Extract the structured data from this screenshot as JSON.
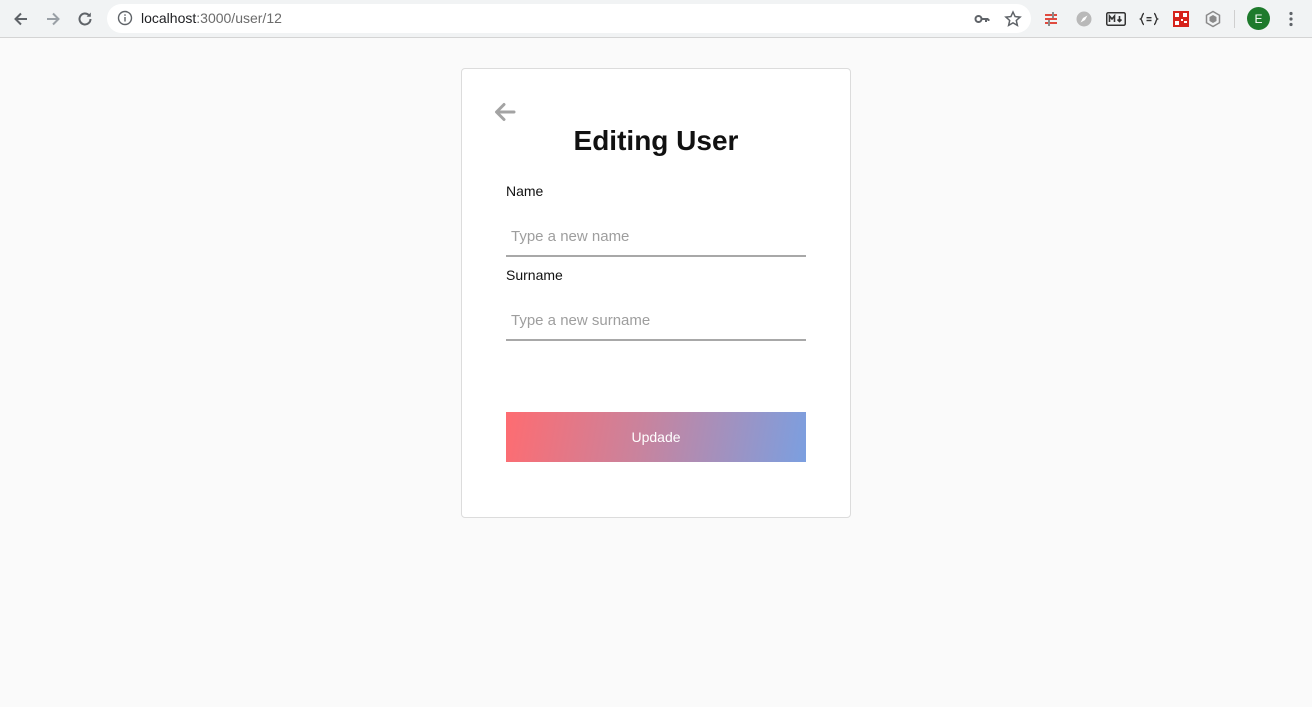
{
  "browser": {
    "url_host": "localhost",
    "url_path": ":3000/user/12",
    "profile_initial": "E",
    "icons": {
      "back": "back-arrow-icon",
      "forward": "forward-arrow-icon",
      "reload": "reload-icon",
      "site_info": "info-icon",
      "password": "key-icon",
      "bookmark": "star-icon",
      "menu": "vertical-dots-icon"
    },
    "extensions": [
      "redux-devtools-icon",
      "compass-icon",
      "markdown-icon",
      "json-formatter-icon",
      "qr-extension-icon",
      "hexagon-extension-icon"
    ]
  },
  "form": {
    "title": "Editing User",
    "name_label": "Name",
    "name_placeholder": "Type a new name",
    "name_value": "",
    "surname_label": "Surname",
    "surname_placeholder": "Type a new surname",
    "surname_value": "",
    "submit_label": "Updade"
  },
  "colors": {
    "gradient_start": "#fe6c71",
    "gradient_end": "#7b9fe0",
    "profile": "#1e7a2c"
  }
}
